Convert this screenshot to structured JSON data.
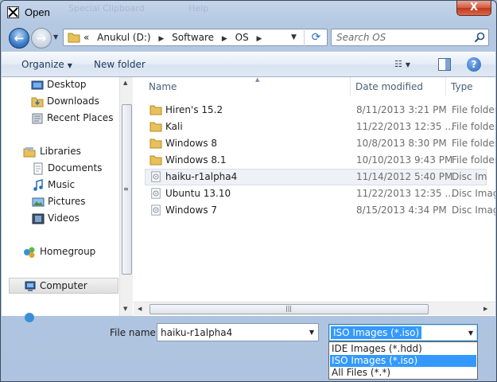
{
  "window": {
    "title": "Open",
    "ghost_menu": [
      "Special Clipboard",
      "Help"
    ],
    "close_label": "X"
  },
  "nav": {
    "back_glyph": "←",
    "forward_glyph": "→",
    "address": {
      "overflow": "«",
      "crumbs": [
        "Anukul (D:)",
        "Software",
        "OS"
      ]
    },
    "search": {
      "placeholder": "Search OS"
    }
  },
  "toolbar": {
    "organize_label": "Organize",
    "new_folder_label": "New folder",
    "help_label": "?"
  },
  "sidebar": {
    "items": [
      {
        "label": "Desktop",
        "icon": "desktop-icon"
      },
      {
        "label": "Downloads",
        "icon": "downloads-folder-icon"
      },
      {
        "label": "Recent Places",
        "icon": "recent-places-icon"
      },
      {
        "label": "Libraries",
        "icon": "libraries-icon"
      },
      {
        "label": "Documents",
        "icon": "documents-icon"
      },
      {
        "label": "Music",
        "icon": "music-icon"
      },
      {
        "label": "Pictures",
        "icon": "pictures-icon"
      },
      {
        "label": "Videos",
        "icon": "videos-icon"
      },
      {
        "label": "Homegroup",
        "icon": "homegroup-icon"
      },
      {
        "label": "Computer",
        "icon": "computer-icon"
      }
    ]
  },
  "files": {
    "columns": [
      "Name",
      "Date modified",
      "Type"
    ],
    "rows": [
      {
        "name": "Hiren's 15.2",
        "date": "8/11/2013 3:21 PM",
        "type": "File folder",
        "icon": "folder-icon"
      },
      {
        "name": "Kali",
        "date": "11/22/2013 12:35 ...",
        "type": "File folder",
        "icon": "folder-icon"
      },
      {
        "name": "Windows 8",
        "date": "10/8/2013 8:30 PM",
        "type": "File folder",
        "icon": "folder-icon"
      },
      {
        "name": "Windows 8.1",
        "date": "10/10/2013 9:43 PM",
        "type": "File folder",
        "icon": "folder-icon"
      },
      {
        "name": "haiku-r1alpha4",
        "date": "11/14/2012 5:40 PM",
        "type": "Disc Image File",
        "icon": "disc-image-icon"
      },
      {
        "name": "Ubuntu 13.10",
        "date": "11/22/2013 12:35 ...",
        "type": "Disc Image File",
        "icon": "disc-image-icon"
      },
      {
        "name": "Windows 7",
        "date": "8/15/2013 4:34 PM",
        "type": "Disc Image File",
        "icon": "disc-image-icon"
      }
    ]
  },
  "bottom": {
    "filename_label": "File name:",
    "filename_value": "haiku-r1alpha4",
    "filter_selected": "ISO Images (*.iso)",
    "filter_options": [
      "IDE Images (*.hdd)",
      "ISO Images (*.iso)",
      "All Files (*.*)"
    ]
  },
  "colors": {
    "selection": "#3399ff",
    "chrome": "#b4c8e2",
    "close": "#c1371b"
  }
}
